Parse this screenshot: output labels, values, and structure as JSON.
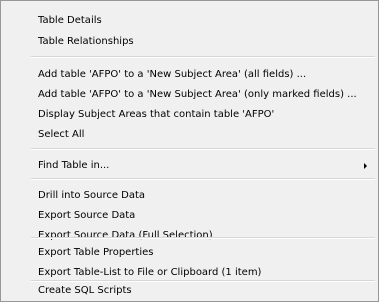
{
  "menu": {
    "items": [
      "Table Details",
      "Table Relationships",
      "Add table 'AFPO' to a 'New Subject Area' (all fields) ...",
      "Add table 'AFPO' to a 'New Subject Area' (only marked fields) ...",
      "Display Subject Areas that contain table 'AFPO'",
      "Select All",
      "Find Table in...",
      "Drill into Source Data",
      "Export Source Data",
      "Export Source Data (Full Selection)",
      "Export Table Properties",
      "Export Table-List to File or Clipboard (1 item)",
      "Create SQL Scripts"
    ],
    "submenu_icon": "chevron-right-icon"
  }
}
